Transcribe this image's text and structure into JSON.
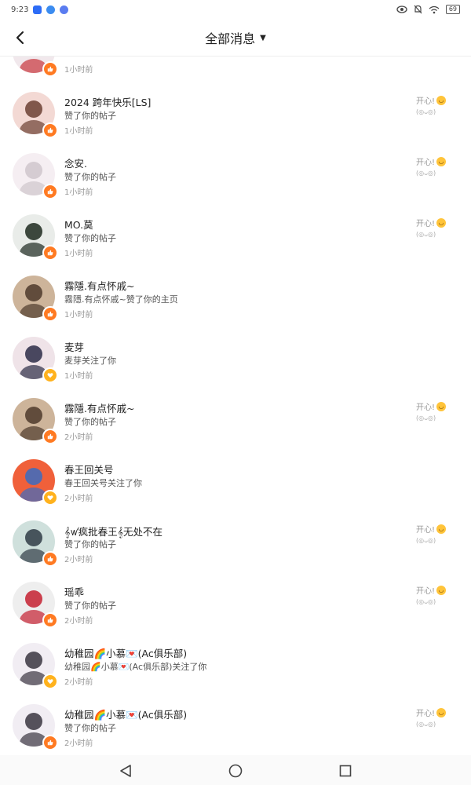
{
  "status_bar": {
    "time": "9:23",
    "battery": "69"
  },
  "header": {
    "title": "全部消息"
  },
  "messages": [
    {
      "name": "",
      "action": "",
      "time": "1小时前",
      "type": "like",
      "reply": "",
      "reply_sub": "",
      "avatar_bg": "#f1e8ec",
      "avatar_fg": "#c8343c"
    },
    {
      "name": "2024 跨年快乐[LS]",
      "action": "赞了你的帖子",
      "time": "1小时前",
      "type": "like",
      "reply": "开心!",
      "reply_sub": "(◎ᴗ◎)",
      "avatar_bg": "#f3d9d4",
      "avatar_fg": "#6b3f32"
    },
    {
      "name": "念安.",
      "action": "赞了你的帖子",
      "time": "1小时前",
      "type": "like",
      "reply": "开心!",
      "reply_sub": "(◎ᴗ◎)",
      "avatar_bg": "#f5eef2",
      "avatar_fg": "#cfc6cc"
    },
    {
      "name": "MO.莫",
      "action": "赞了你的帖子",
      "time": "1小时前",
      "type": "like",
      "reply": "开心!",
      "reply_sub": "(◎ᴗ◎)",
      "avatar_bg": "#e9ece9",
      "avatar_fg": "#1d2a1f"
    },
    {
      "name": "霧隱.有点怀戚~",
      "action": "霧隱.有点怀戚~赞了你的主页",
      "time": "1小时前",
      "type": "like",
      "reply": "",
      "reply_sub": "",
      "avatar_bg": "#cdb49a",
      "avatar_fg": "#4e3a2c"
    },
    {
      "name": "麦芽",
      "action": "麦芽关注了你",
      "time": "1小时前",
      "type": "follow",
      "reply": "",
      "reply_sub": "",
      "avatar_bg": "#efe3e8",
      "avatar_fg": "#2c2c46"
    },
    {
      "name": "霧隱.有点怀戚~",
      "action": "赞了你的帖子",
      "time": "2小时前",
      "type": "like",
      "reply": "开心!",
      "reply_sub": "(◎ᴗ◎)",
      "avatar_bg": "#cdb49a",
      "avatar_fg": "#4e3a2c"
    },
    {
      "name": "春王回关号",
      "action": "春王回关号关注了你",
      "time": "2小时前",
      "type": "follow",
      "reply": "",
      "reply_sub": "",
      "avatar_bg": "#f0603a",
      "avatar_fg": "#3a6cc2"
    },
    {
      "name": "𝄞ꪝ疯批春王𝄞无处不在",
      "action": "赞了你的帖子",
      "time": "2小时前",
      "type": "like",
      "reply": "开心!",
      "reply_sub": "(◎ᴗ◎)",
      "avatar_bg": "#cfe0dc",
      "avatar_fg": "#2f3b45"
    },
    {
      "name": "瑶乖",
      "action": "赞了你的帖子",
      "time": "2小时前",
      "type": "like",
      "reply": "开心!",
      "reply_sub": "(◎ᴗ◎)",
      "avatar_bg": "#eeeeee",
      "avatar_fg": "#c42030"
    },
    {
      "name": "幼稚园🌈小慕💌(Ac俱乐部)",
      "action": "幼稚园🌈小慕💌(Ac俱乐部)关注了你",
      "time": "2小时前",
      "type": "follow",
      "reply": "",
      "reply_sub": "",
      "avatar_bg": "#f1edf3",
      "avatar_fg": "#3a3540"
    },
    {
      "name": "幼稚园🌈小慕💌(Ac俱乐部)",
      "action": "赞了你的帖子",
      "time": "2小时前",
      "type": "like",
      "reply": "开心!",
      "reply_sub": "(◎ᴗ◎)",
      "avatar_bg": "#f1edf3",
      "avatar_fg": "#3a3540"
    }
  ]
}
